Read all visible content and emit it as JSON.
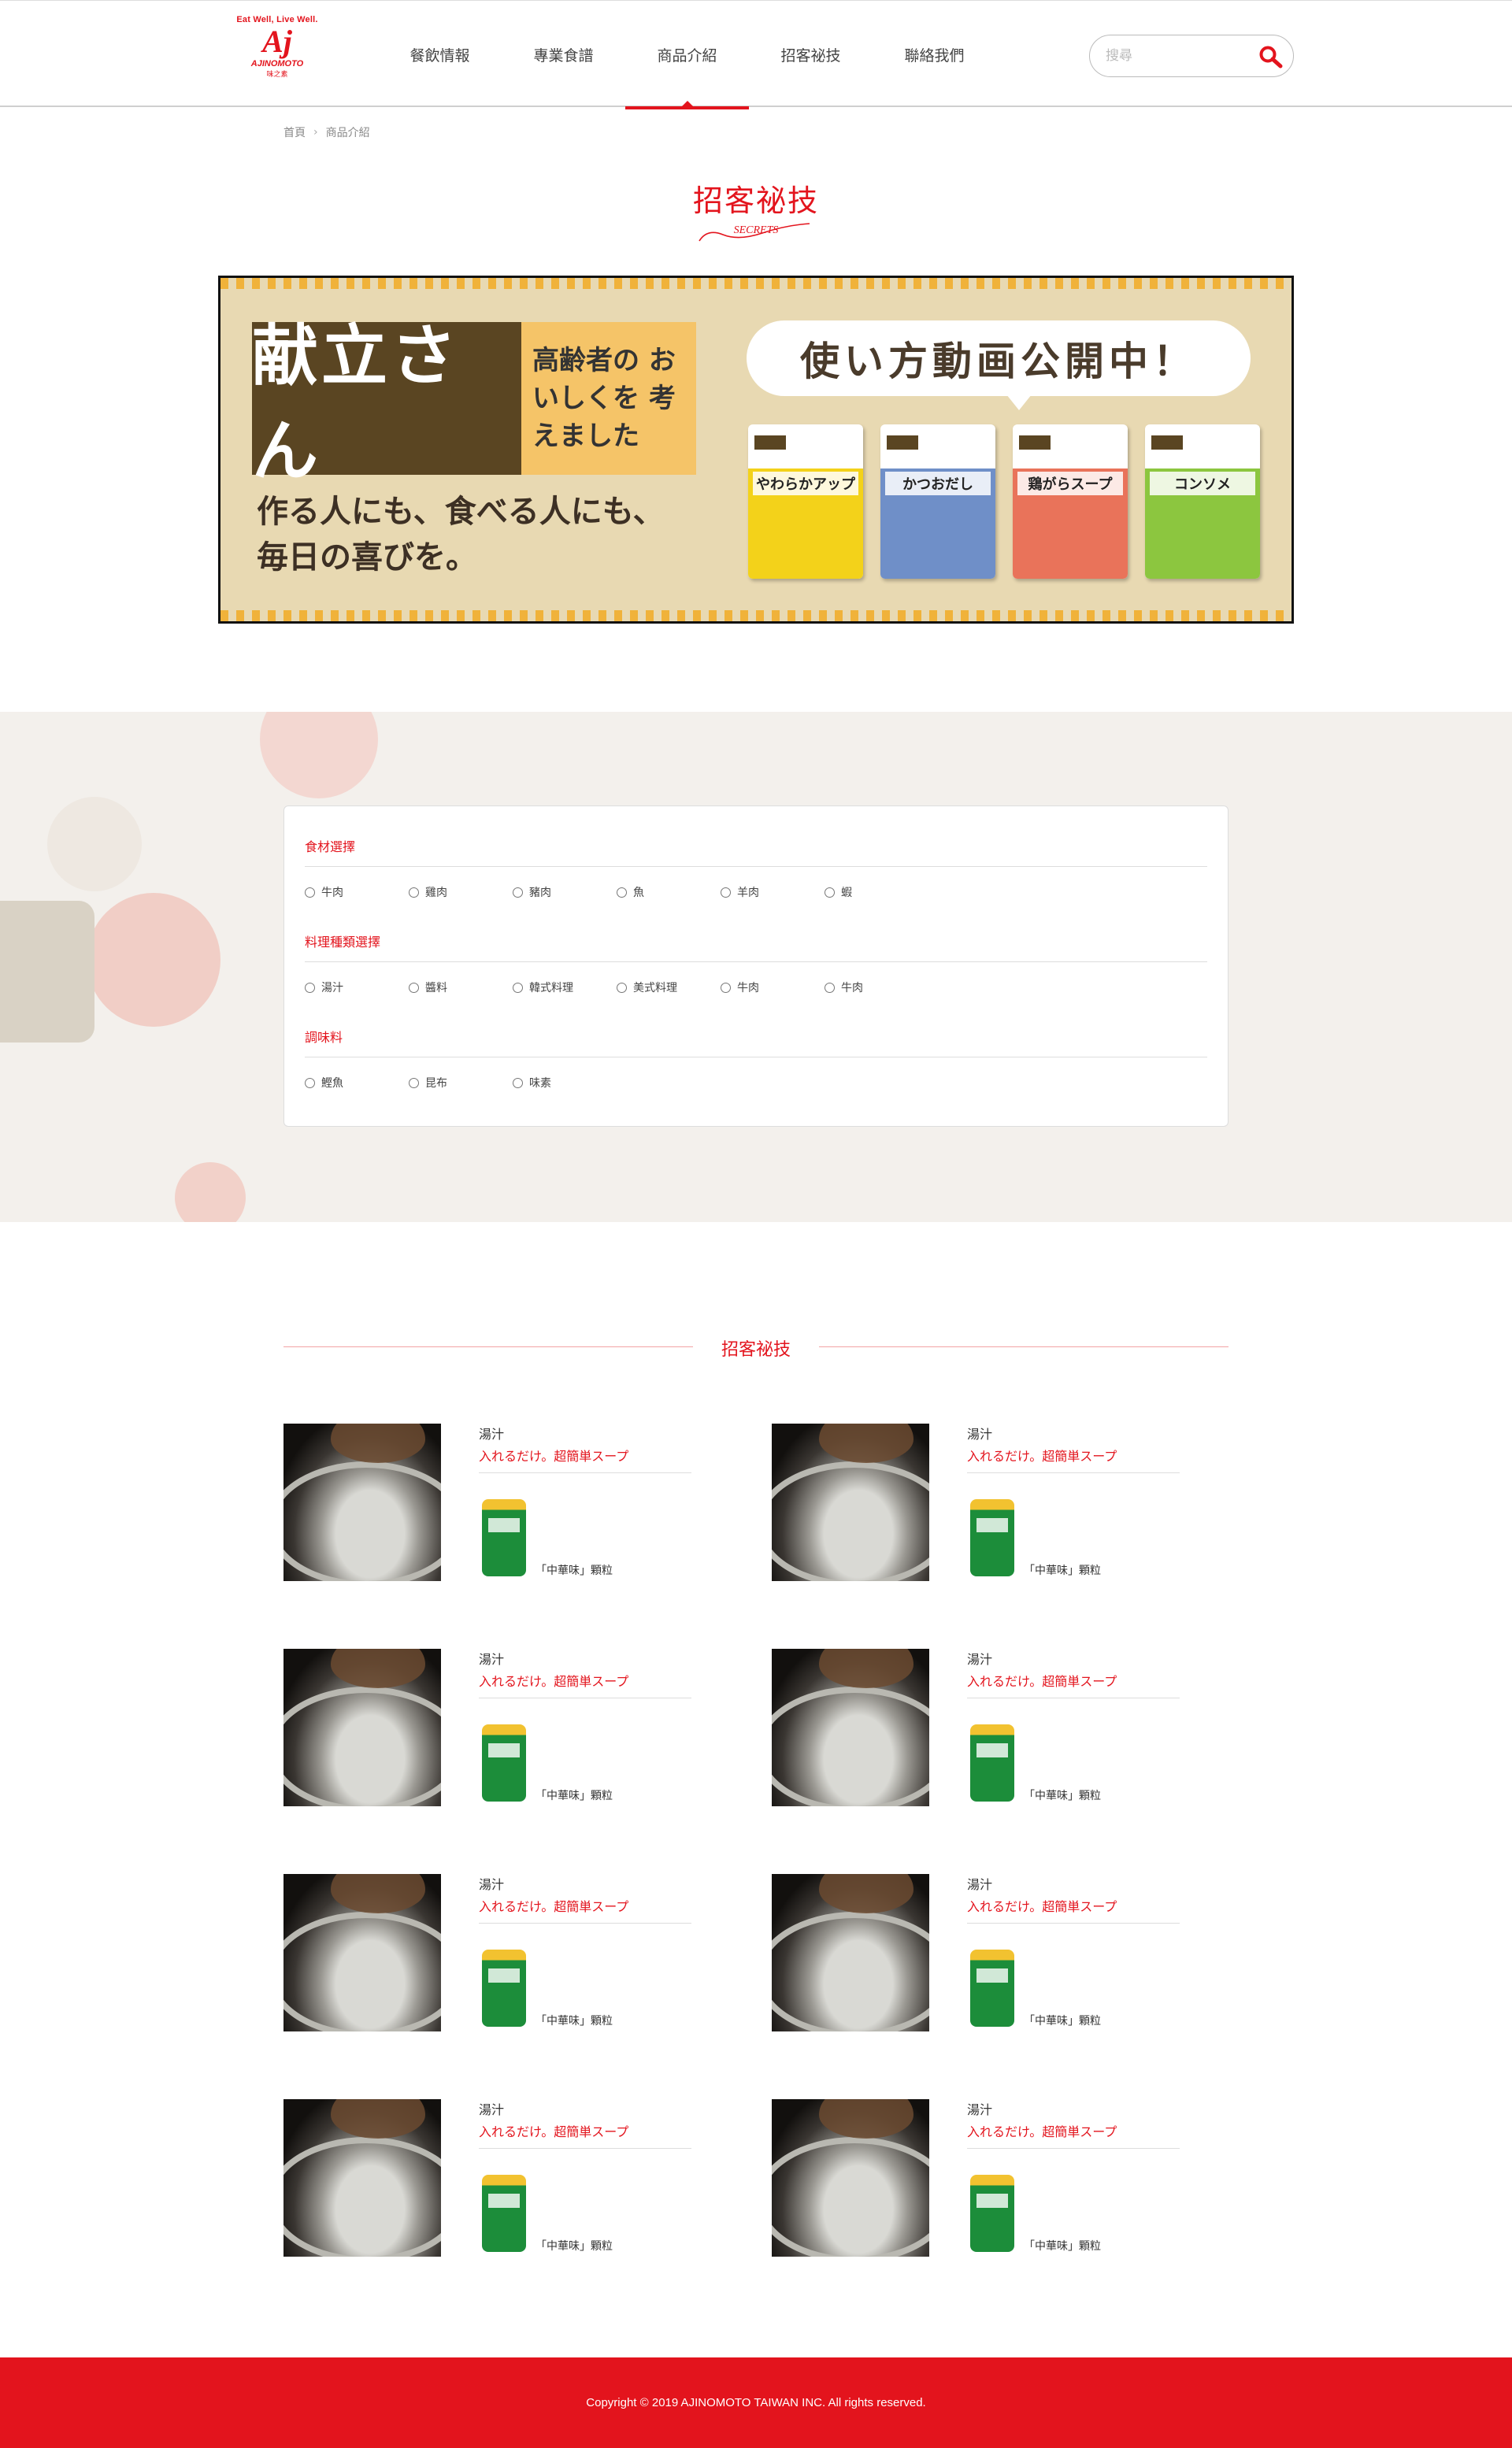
{
  "brand": {
    "tagline": "Eat Well, Live Well.",
    "mark": "Aj",
    "name": "AJINOMOTO",
    "name_cn": "味之素",
    "color": "#e3141d"
  },
  "nav": {
    "items": [
      {
        "label": "餐飲情報"
      },
      {
        "label": "專業食譜"
      },
      {
        "label": "商品介紹",
        "active": true
      },
      {
        "label": "招客祕技"
      },
      {
        "label": "聯絡我們"
      }
    ]
  },
  "search": {
    "placeholder": "搜尋",
    "icon": "search-icon"
  },
  "breadcrumb": {
    "home": "首頁",
    "current": "商品介紹"
  },
  "heading": {
    "title": "招客祕技",
    "subtitle": "SECRETS"
  },
  "banner": {
    "logo_text": "献立さん",
    "tag_text": "高齢者の おいしくを 考えました",
    "slogan_line1": "作る人にも、食べる人にも、",
    "slogan_line2": "毎日の喜びを。",
    "bubble_text": "使い方動画公開中！",
    "packages": [
      {
        "label": "やわらかアップ",
        "color": "#f3d21a"
      },
      {
        "label": "かつおだし",
        "color": "#6f8fc8"
      },
      {
        "label": "鶏がらスープ",
        "color": "#e9735a"
      },
      {
        "label": "コンソメ",
        "color": "#8cc63f"
      }
    ]
  },
  "filters": [
    {
      "title": "食材選擇",
      "options": [
        "牛肉",
        "雞肉",
        "豬肉",
        "魚",
        "羊肉",
        "蝦"
      ]
    },
    {
      "title": "料理種類選擇",
      "options": [
        "湯汁",
        "醬料",
        "韓式料理",
        "美式料理",
        "牛肉",
        "牛肉"
      ]
    },
    {
      "title": "調味料",
      "options": [
        "鰹魚",
        "昆布",
        "味素"
      ]
    }
  ],
  "results": {
    "heading": "招客祕技",
    "cards": [
      {
        "category": "湯汁",
        "title": "入れるだけ。超簡単スープ",
        "product": "「中華味」顆粒"
      },
      {
        "category": "湯汁",
        "title": "入れるだけ。超簡単スープ",
        "product": "「中華味」顆粒"
      },
      {
        "category": "湯汁",
        "title": "入れるだけ。超簡単スープ",
        "product": "「中華味」顆粒"
      },
      {
        "category": "湯汁",
        "title": "入れるだけ。超簡単スープ",
        "product": "「中華味」顆粒"
      },
      {
        "category": "湯汁",
        "title": "入れるだけ。超簡単スープ",
        "product": "「中華味」顆粒"
      },
      {
        "category": "湯汁",
        "title": "入れるだけ。超簡単スープ",
        "product": "「中華味」顆粒"
      },
      {
        "category": "湯汁",
        "title": "入れるだけ。超簡単スープ",
        "product": "「中華味」顆粒"
      },
      {
        "category": "湯汁",
        "title": "入れるだけ。超簡単スープ",
        "product": "「中華味」顆粒"
      }
    ]
  },
  "footer": {
    "copyright": "Copyright © 2019 AJINOMOTO TAIWAN INC. All rights reserved."
  }
}
